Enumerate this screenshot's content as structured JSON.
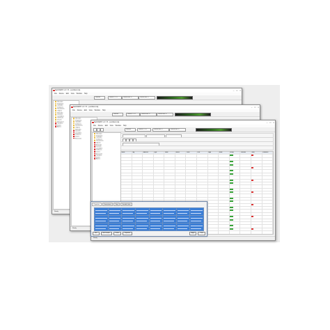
{
  "window_title": "NetSNMP 1.0.7.5 - [untitled.nis]",
  "menu": [
    "File",
    "Device",
    "Edit",
    "View",
    "Window",
    "Help"
  ],
  "toolbar": {
    "tab1": "Devices",
    "tab2": "Device: 1.2.3",
    "tab3": "Device Bus: 8",
    "tab4": "Device Bus: 8"
  },
  "tree_items": [
    "Structure",
    "Properties",
    "Variables",
    "Instances",
    "Parameters",
    "Objects",
    "Networks",
    "Datasets",
    "Controllers",
    "Interfaces",
    "Drivers",
    "Resources",
    "Functions",
    "Events",
    "Alarms"
  ],
  "grid_headers": [
    "Name",
    "Tag",
    "Address",
    "Type",
    "Value",
    "Status",
    "Units",
    "Low",
    "High",
    "Mode",
    "Group",
    "Channel",
    "Scan",
    "Comment"
  ],
  "dialog_tabs": [
    "Properties",
    "Connections",
    "Tags",
    "Variable Links"
  ],
  "dialog_buttons": [
    "New",
    "Edit Variable",
    "Delete",
    "Properties",
    "Apply",
    "Close"
  ],
  "status_text": "Ready",
  "colors": {
    "selection": "#3b7ed6",
    "meter": "#4d9b2e",
    "marker": "#d22222"
  }
}
